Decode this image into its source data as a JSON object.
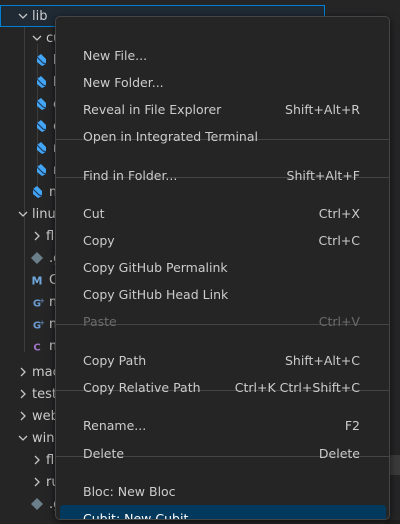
{
  "explorer": {
    "rows": [
      {
        "label": "lib",
        "chev": "down",
        "icon": "",
        "indent": 0
      },
      {
        "label": "cu",
        "chev": "down",
        "icon": "",
        "indent": 1
      },
      {
        "label": "b",
        "chev": "",
        "icon": "dart",
        "indent": 2
      },
      {
        "label": "b",
        "chev": "",
        "icon": "dart",
        "indent": 2
      },
      {
        "label": "c",
        "chev": "",
        "icon": "dart",
        "indent": 2
      },
      {
        "label": "c",
        "chev": "",
        "icon": "dart",
        "indent": 2
      },
      {
        "label": "n",
        "chev": "",
        "icon": "dart",
        "indent": 2
      },
      {
        "label": "n",
        "chev": "",
        "icon": "dart",
        "indent": 2
      },
      {
        "label": "m",
        "chev": "",
        "icon": "dart",
        "indent": 1
      },
      {
        "label": "linu",
        "chev": "down",
        "icon": "",
        "indent": 0
      },
      {
        "label": "flu",
        "chev": "right",
        "icon": "",
        "indent": 1
      },
      {
        "label": ".g",
        "chev": "",
        "icon": "git",
        "indent": 1
      },
      {
        "label": "CN",
        "chev": "",
        "icon": "cmake",
        "indent": 1
      },
      {
        "label": "m",
        "chev": "",
        "icon": "cpp",
        "indent": 1
      },
      {
        "label": "m",
        "chev": "",
        "icon": "cpp",
        "indent": 1
      },
      {
        "label": "m",
        "chev": "",
        "icon": "c",
        "indent": 1
      },
      {
        "label": "mac",
        "chev": "right",
        "icon": "",
        "indent": 0
      },
      {
        "label": "test",
        "chev": "right",
        "icon": "",
        "indent": 0
      },
      {
        "label": "web",
        "chev": "right",
        "icon": "",
        "indent": 0
      },
      {
        "label": "win",
        "chev": "down",
        "icon": "",
        "indent": 0
      },
      {
        "label": "flu",
        "chev": "right",
        "icon": "",
        "indent": 1
      },
      {
        "label": "ru",
        "chev": "right",
        "icon": "",
        "indent": 1
      },
      {
        "label": ".gitignore",
        "chev": "",
        "icon": "git",
        "indent": 1
      }
    ]
  },
  "menu": {
    "items": [
      {
        "label": "New File...",
        "shortcut": "",
        "disabled": false,
        "active": false
      },
      {
        "label": "New Folder...",
        "shortcut": "",
        "disabled": false,
        "active": false
      },
      {
        "label": "Reveal in File Explorer",
        "shortcut": "Shift+Alt+R",
        "disabled": false,
        "active": false
      },
      {
        "label": "Open in Integrated Terminal",
        "shortcut": "",
        "disabled": false,
        "active": false
      },
      {
        "label": "Find in Folder...",
        "shortcut": "Shift+Alt+F",
        "disabled": false,
        "active": false
      },
      {
        "label": "Cut",
        "shortcut": "Ctrl+X",
        "disabled": false,
        "active": false
      },
      {
        "label": "Copy",
        "shortcut": "Ctrl+C",
        "disabled": false,
        "active": false
      },
      {
        "label": "Copy GitHub Permalink",
        "shortcut": "",
        "disabled": false,
        "active": false
      },
      {
        "label": "Copy GitHub Head Link",
        "shortcut": "",
        "disabled": false,
        "active": false
      },
      {
        "label": "Paste",
        "shortcut": "Ctrl+V",
        "disabled": true,
        "active": false
      },
      {
        "label": "Copy Path",
        "shortcut": "Shift+Alt+C",
        "disabled": false,
        "active": false
      },
      {
        "label": "Copy Relative Path",
        "shortcut": "Ctrl+K Ctrl+Shift+C",
        "disabled": false,
        "active": false
      },
      {
        "label": "Rename...",
        "shortcut": "F2",
        "disabled": false,
        "active": false
      },
      {
        "label": "Delete",
        "shortcut": "Delete",
        "disabled": false,
        "active": false
      },
      {
        "label": "Bloc: New Bloc",
        "shortcut": "",
        "disabled": false,
        "active": false
      },
      {
        "label": "Cubit: New Cubit",
        "shortcut": "",
        "disabled": false,
        "active": true
      }
    ]
  },
  "colors": {
    "menu_bg": "#252526",
    "active_bg": "#04395e",
    "selection_border": "#007fd4",
    "dart_blue": "#42a5f5",
    "cmake_blue": "#6fa8dc",
    "cpp_blue": "#6c9bd2",
    "c_purple": "#a074c4",
    "git_gray": "#6b7f8a"
  }
}
